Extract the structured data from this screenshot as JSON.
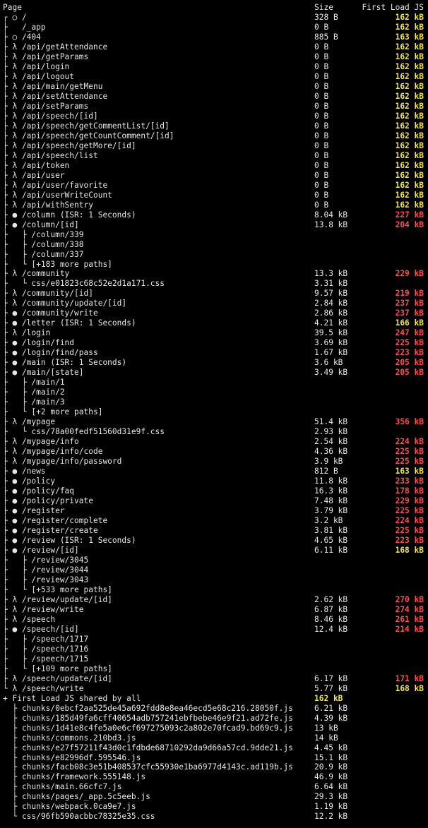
{
  "colors": {
    "yellow": "#f2e54f",
    "red": "#ff4d4d",
    "text": "#e6e6e6",
    "background": "#000000"
  },
  "header": {
    "page": "Page",
    "size": "Size",
    "first_load_js": "First Load JS"
  },
  "rows": [
    {
      "page": "┌ ○ /",
      "size": "328 B",
      "js": "162 kB",
      "c": "yellow"
    },
    {
      "page": "├   /_app",
      "size": "0 B",
      "js": "162 kB",
      "c": "yellow"
    },
    {
      "page": "├ ○ /404",
      "size": "885 B",
      "js": "163 kB",
      "c": "yellow"
    },
    {
      "page": "├ λ /api/getAttendance",
      "size": "0 B",
      "js": "162 kB",
      "c": "yellow"
    },
    {
      "page": "├ λ /api/getParams",
      "size": "0 B",
      "js": "162 kB",
      "c": "yellow"
    },
    {
      "page": "├ λ /api/login",
      "size": "0 B",
      "js": "162 kB",
      "c": "yellow"
    },
    {
      "page": "├ λ /api/logout",
      "size": "0 B",
      "js": "162 kB",
      "c": "yellow"
    },
    {
      "page": "├ λ /api/main/getMenu",
      "size": "0 B",
      "js": "162 kB",
      "c": "yellow"
    },
    {
      "page": "├ λ /api/setAttendance",
      "size": "0 B",
      "js": "162 kB",
      "c": "yellow"
    },
    {
      "page": "├ λ /api/setParams",
      "size": "0 B",
      "js": "162 kB",
      "c": "yellow"
    },
    {
      "page": "├ λ /api/speech/[id]",
      "size": "0 B",
      "js": "162 kB",
      "c": "yellow"
    },
    {
      "page": "├ λ /api/speech/getCommentList/[id]",
      "size": "0 B",
      "js": "162 kB",
      "c": "yellow"
    },
    {
      "page": "├ λ /api/speech/getCountComment/[id]",
      "size": "0 B",
      "js": "162 kB",
      "c": "yellow"
    },
    {
      "page": "├ λ /api/speech/getMore/[id]",
      "size": "0 B",
      "js": "162 kB",
      "c": "yellow"
    },
    {
      "page": "├ λ /api/speech/list",
      "size": "0 B",
      "js": "162 kB",
      "c": "yellow"
    },
    {
      "page": "├ λ /api/token",
      "size": "0 B",
      "js": "162 kB",
      "c": "yellow"
    },
    {
      "page": "├ λ /api/user",
      "size": "0 B",
      "js": "162 kB",
      "c": "yellow"
    },
    {
      "page": "├ λ /api/user/favorite",
      "size": "0 B",
      "js": "162 kB",
      "c": "yellow"
    },
    {
      "page": "├ λ /api/userWriteCount",
      "size": "0 B",
      "js": "162 kB",
      "c": "yellow"
    },
    {
      "page": "├ λ /api/withSentry",
      "size": "0 B",
      "js": "162 kB",
      "c": "yellow"
    },
    {
      "page": "├ ● /column (ISR: 1 Seconds)",
      "size": "8.04 kB",
      "js": "227 kB",
      "c": "red"
    },
    {
      "page": "├ ● /column/[id]",
      "size": "13.8 kB",
      "js": "204 kB",
      "c": "red"
    },
    {
      "page": "├   ├ /column/339",
      "size": "",
      "js": "",
      "c": ""
    },
    {
      "page": "├   ├ /column/338",
      "size": "",
      "js": "",
      "c": ""
    },
    {
      "page": "├   ├ /column/337",
      "size": "",
      "js": "",
      "c": ""
    },
    {
      "page": "├   └ [+183 more paths]",
      "size": "",
      "js": "",
      "c": ""
    },
    {
      "page": "├ λ /community",
      "size": "13.3 kB",
      "js": "229 kB",
      "c": "red"
    },
    {
      "page": "├   └ css/e01823c68c52e2d1a171.css",
      "size": "3.31 kB",
      "js": "",
      "c": ""
    },
    {
      "page": "├ λ /community/[id]",
      "size": "9.57 kB",
      "js": "219 kB",
      "c": "red"
    },
    {
      "page": "├ λ /community/update/[id]",
      "size": "2.84 kB",
      "js": "237 kB",
      "c": "red"
    },
    {
      "page": "├ ● /community/write",
      "size": "2.86 kB",
      "js": "237 kB",
      "c": "red"
    },
    {
      "page": "├ ● /letter (ISR: 1 Seconds)",
      "size": "4.21 kB",
      "js": "166 kB",
      "c": "yellow"
    },
    {
      "page": "├ λ /login",
      "size": "39.5 kB",
      "js": "247 kB",
      "c": "red"
    },
    {
      "page": "├ ● /login/find",
      "size": "3.69 kB",
      "js": "225 kB",
      "c": "red"
    },
    {
      "page": "├ ● /login/find/pass",
      "size": "1.67 kB",
      "js": "223 kB",
      "c": "red"
    },
    {
      "page": "├ ● /main (ISR: 1 Seconds)",
      "size": "3.6 kB",
      "js": "205 kB",
      "c": "red"
    },
    {
      "page": "├ ● /main/[state]",
      "size": "3.49 kB",
      "js": "205 kB",
      "c": "red"
    },
    {
      "page": "├   ├ /main/1",
      "size": "",
      "js": "",
      "c": ""
    },
    {
      "page": "├   ├ /main/2",
      "size": "",
      "js": "",
      "c": ""
    },
    {
      "page": "├   ├ /main/3",
      "size": "",
      "js": "",
      "c": ""
    },
    {
      "page": "├   └ [+2 more paths]",
      "size": "",
      "js": "",
      "c": ""
    },
    {
      "page": "├ λ /mypage",
      "size": "51.4 kB",
      "js": "356 kB",
      "c": "red"
    },
    {
      "page": "├   └ css/78a00fedf51560d31e9f.css",
      "size": "2.93 kB",
      "js": "",
      "c": ""
    },
    {
      "page": "├ λ /mypage/info",
      "size": "2.54 kB",
      "js": "224 kB",
      "c": "red"
    },
    {
      "page": "├ λ /mypage/info/code",
      "size": "4.36 kB",
      "js": "225 kB",
      "c": "red"
    },
    {
      "page": "├ λ /mypage/info/password",
      "size": "3.9 kB",
      "js": "225 kB",
      "c": "red"
    },
    {
      "page": "├ ● /news",
      "size": "812 B",
      "js": "163 kB",
      "c": "yellow"
    },
    {
      "page": "├ ● /policy",
      "size": "11.8 kB",
      "js": "233 kB",
      "c": "red"
    },
    {
      "page": "├ ● /policy/faq",
      "size": "16.3 kB",
      "js": "178 kB",
      "c": "red"
    },
    {
      "page": "├ ● /policy/private",
      "size": "7.48 kB",
      "js": "229 kB",
      "c": "red"
    },
    {
      "page": "├ ● /register",
      "size": "3.79 kB",
      "js": "225 kB",
      "c": "red"
    },
    {
      "page": "├ ● /register/complete",
      "size": "3.2 kB",
      "js": "224 kB",
      "c": "red"
    },
    {
      "page": "├ ● /register/create",
      "size": "3.81 kB",
      "js": "225 kB",
      "c": "red"
    },
    {
      "page": "├ ● /review (ISR: 1 Seconds)",
      "size": "4.65 kB",
      "js": "223 kB",
      "c": "red"
    },
    {
      "page": "├ ● /review/[id]",
      "size": "6.11 kB",
      "js": "168 kB",
      "c": "yellow"
    },
    {
      "page": "├   ├ /review/3045",
      "size": "",
      "js": "",
      "c": ""
    },
    {
      "page": "├   ├ /review/3044",
      "size": "",
      "js": "",
      "c": ""
    },
    {
      "page": "├   ├ /review/3043",
      "size": "",
      "js": "",
      "c": ""
    },
    {
      "page": "├   └ [+533 more paths]",
      "size": "",
      "js": "",
      "c": ""
    },
    {
      "page": "├ λ /review/update/[id]",
      "size": "2.62 kB",
      "js": "270 kB",
      "c": "red"
    },
    {
      "page": "├ λ /review/write",
      "size": "6.87 kB",
      "js": "274 kB",
      "c": "red"
    },
    {
      "page": "├ λ /speech",
      "size": "8.46 kB",
      "js": "261 kB",
      "c": "red"
    },
    {
      "page": "├ ● /speech/[id]",
      "size": "12.4 kB",
      "js": "214 kB",
      "c": "red"
    },
    {
      "page": "├   ├ /speech/1717",
      "size": "",
      "js": "",
      "c": ""
    },
    {
      "page": "├   ├ /speech/1716",
      "size": "",
      "js": "",
      "c": ""
    },
    {
      "page": "├   ├ /speech/1715",
      "size": "",
      "js": "",
      "c": ""
    },
    {
      "page": "├   └ [+109 more paths]",
      "size": "",
      "js": "",
      "c": ""
    },
    {
      "page": "├ λ /speech/update/[id]",
      "size": "6.17 kB",
      "js": "171 kB",
      "c": "red"
    },
    {
      "page": "└ λ /speech/write",
      "size": "5.77 kB",
      "js": "168 kB",
      "c": "yellow"
    },
    {
      "page": "+ First Load JS shared by all",
      "size": "162 kB",
      "js": "",
      "c": "",
      "sc": "yellow"
    },
    {
      "page": "  ├ chunks/0ebcf2aa525de45a692fdd8e8ea46ecd5e68c216.28050f.js",
      "size": "6.21 kB",
      "js": "",
      "c": ""
    },
    {
      "page": "  ├ chunks/185d49fa6cff40654adb757241ebfbebe46e9f21.ad72fe.js",
      "size": "4.39 kB",
      "js": "",
      "c": ""
    },
    {
      "page": "  ├ chunks/1d41e8c4fe5a0e6cf697275093c2a802e70fcad9.bd69c9.js",
      "size": "13 kB",
      "js": "",
      "c": ""
    },
    {
      "page": "  ├ chunks/commons.210bd3.js",
      "size": "14 kB",
      "js": "",
      "c": ""
    },
    {
      "page": "  ├ chunks/e27f57211f43d0c1fdbde68710292da9d66a57cd.9dde21.js",
      "size": "4.45 kB",
      "js": "",
      "c": ""
    },
    {
      "page": "  ├ chunks/e82996df.595546.js",
      "size": "15.1 kB",
      "js": "",
      "c": ""
    },
    {
      "page": "  ├ chunks/facb08c3e51b408537cfc55930e1ba6977d4143c.ad119b.js",
      "size": "20.9 kB",
      "js": "",
      "c": ""
    },
    {
      "page": "  ├ chunks/framework.555148.js",
      "size": "46.9 kB",
      "js": "",
      "c": ""
    },
    {
      "page": "  ├ chunks/main.66cfc7.js",
      "size": "6.64 kB",
      "js": "",
      "c": ""
    },
    {
      "page": "  ├ chunks/pages/_app.5c5eeb.js",
      "size": "29.3 kB",
      "js": "",
      "c": ""
    },
    {
      "page": "  ├ chunks/webpack.0ca9e7.js",
      "size": "1.19 kB",
      "js": "",
      "c": ""
    },
    {
      "page": "  └ css/96fb590acbbc78325e35.css",
      "size": "12.2 kB",
      "js": "",
      "c": ""
    }
  ]
}
